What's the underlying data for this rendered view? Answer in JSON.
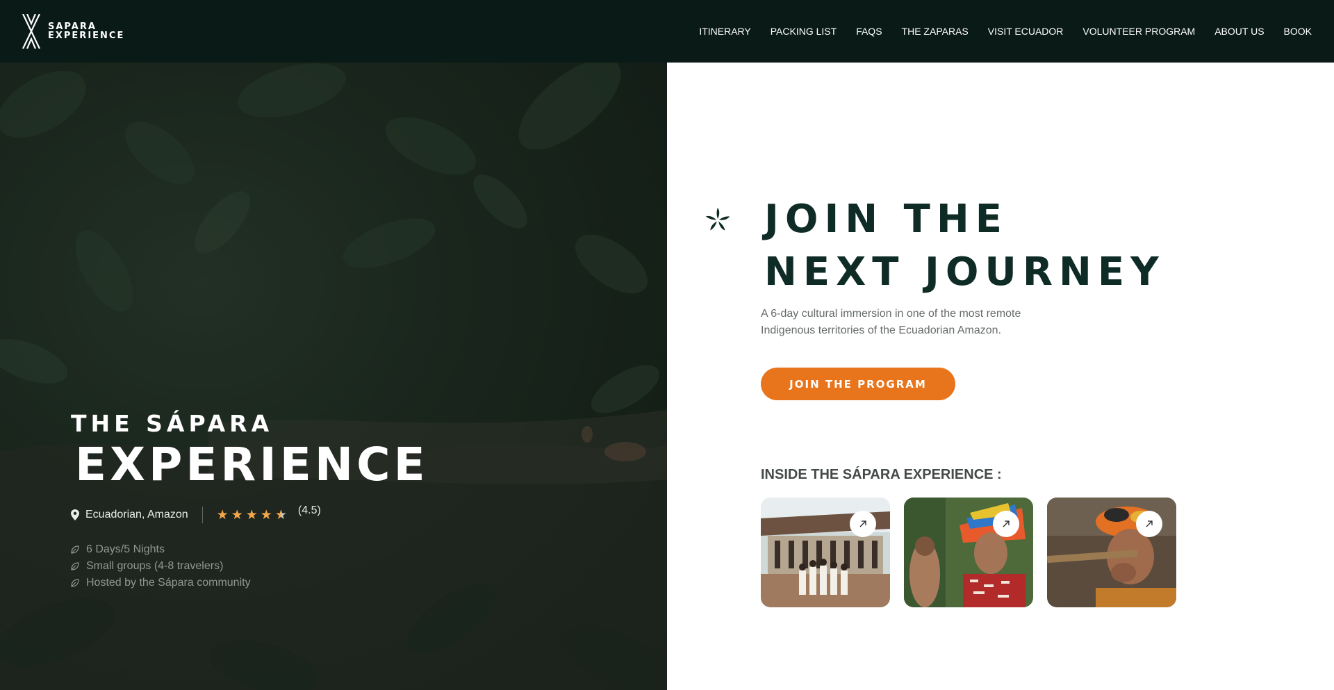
{
  "brand": {
    "line1": "SAPARA",
    "line2": "EXPERIENCE"
  },
  "nav": [
    {
      "label": "ITINERARY"
    },
    {
      "label": "PACKING LIST"
    },
    {
      "label": "FAQS"
    },
    {
      "label": "THE ZAPARAS"
    },
    {
      "label": "VISIT ECUADOR"
    },
    {
      "label": "VOLUNTEER PROGRAM"
    },
    {
      "label": "ABOUT US"
    },
    {
      "label": "BOOK"
    }
  ],
  "hero": {
    "kicker": "THE SÁPARA",
    "title": "EXPERIENCE",
    "location": "Ecuadorian, Amazon",
    "rating_value": 4.5,
    "rating_text": "(4.5)",
    "features": [
      "6 Days/5 Nights",
      "Small groups (4-8 travelers)",
      "Hosted by the Sápara community"
    ]
  },
  "join": {
    "title_line1": "JOIN THE",
    "title_line2": "NEXT JOURNEY",
    "description": "A 6-day cultural immersion in one of the most remote Indigenous territories of the Ecuadorian Amazon.",
    "cta": "JOIN THE PROGRAM",
    "inside_label": "INSIDE THE SÁPARA EXPERIENCE :"
  },
  "thumbs": [
    {
      "name": "community-photo"
    },
    {
      "name": "elder-headdress-photo"
    },
    {
      "name": "elder-flute-photo"
    }
  ],
  "colors": {
    "header_bg": "#0a1a17",
    "accent": "#e8741c",
    "title_dark": "#0f2b25",
    "star": "#f2a74b"
  },
  "icons": [
    "location-pin-icon",
    "star-icon",
    "leaf-icon",
    "arrow-up-right-icon",
    "sparkle-icon",
    "logo-mark-icon"
  ]
}
